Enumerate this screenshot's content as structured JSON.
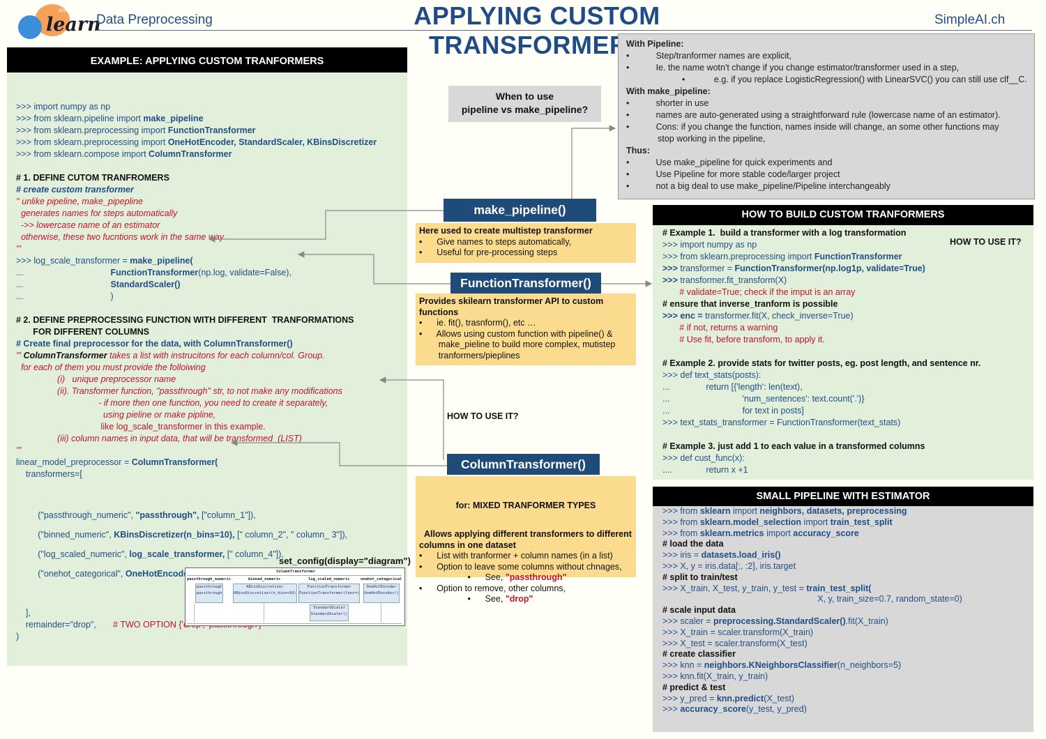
{
  "header": {
    "logo_word": "learn",
    "logo_tag": "scikit",
    "subtitle": "Data Preprocessing",
    "title": "APPLYING CUSTOM TRANSFORMERS",
    "site": "SimpleAI.ch"
  },
  "left": {
    "heading": "EXAMPLE: APPLYING CUSTOM TRANFORMERS",
    "lines": [
      [
        [
          "b",
          ">>> import numpy as np"
        ]
      ],
      [
        [
          "b",
          ">>> from sklearn.pipeline import "
        ],
        [
          "bb",
          "make_pipeline"
        ]
      ],
      [
        [
          "b",
          ">>> from sklearn.preprocessing import "
        ],
        [
          "bb",
          "FunctionTransformer"
        ]
      ],
      [
        [
          "b",
          ">>> from sklearn.preprocessing import "
        ],
        [
          "bb",
          "OneHotEncoder, StandardScaler, KBinsDiscretizer"
        ]
      ],
      [
        [
          "b",
          ">>> from sklearn.compose import "
        ],
        [
          "bb",
          "ColumnTransformer"
        ]
      ],
      [
        [
          "b",
          " "
        ]
      ],
      [
        [
          "k",
          "# 1. DEFINE CUTOM TRANFROMERS"
        ]
      ],
      [
        [
          "bi",
          "# create custom transformer"
        ]
      ],
      [
        [
          "r",
          "'' unlike pipeline, make_pipepline"
        ]
      ],
      [
        [
          "r",
          "  generates names for steps automatically"
        ]
      ],
      [
        [
          "r",
          "  ->> lowercase name of an estimator"
        ]
      ],
      [
        [
          "r",
          "  otherwise, these two fucntions work in the same way"
        ]
      ],
      [
        [
          "r",
          "'''"
        ]
      ],
      [
        [
          "b",
          ">>> log_scale_transformer = "
        ],
        [
          "bb",
          "make_pipeline("
        ]
      ],
      [
        [
          "b",
          "...                                    "
        ],
        [
          "bb",
          "FunctionTransformer"
        ],
        [
          "b",
          "(np.log, validate=False),"
        ]
      ],
      [
        [
          "b",
          "...                                    "
        ],
        [
          "bb",
          "StandardScaler()"
        ]
      ],
      [
        [
          "b",
          "...                                    )"
        ]
      ],
      [
        [
          "b",
          " "
        ]
      ],
      [
        [
          "k",
          "# 2. DEFINE PREPROCESSING FUNCTION WITH DIFFERENT  TRANFORMATIONS"
        ]
      ],
      [
        [
          "k",
          "       FOR DIFFERENT COLUMNS"
        ]
      ],
      [
        [
          "bb",
          "# Create final preprocessor for the data, with ColumnTransformer()"
        ]
      ],
      [
        [
          "r",
          "''' "
        ],
        [
          "ki",
          "ColumnTransformer"
        ],
        [
          "r",
          " takes a list with instrucitons for each column/col. Group."
        ]
      ],
      [
        [
          "r",
          "  for each of them you must provide the folloiwing"
        ]
      ],
      [
        [
          "r",
          "                 (i)   unique preprocessor name"
        ]
      ],
      [
        [
          "r",
          "                 (ii). Transformer function, \"passthrough\" str, to not make any modifications"
        ]
      ],
      [
        [
          "r",
          "                                  - if more then one function, you need to create it separately,"
        ]
      ],
      [
        [
          "r",
          "                                    using pieline or make pipline,"
        ]
      ],
      [
        [
          "rn",
          "                                   like log_scale_transformer in this example."
        ]
      ],
      [
        [
          "r",
          "                 (iii) column names in input data, that will be transformed  (LIST)"
        ]
      ],
      [
        [
          "r",
          "'''"
        ]
      ],
      [
        [
          "b",
          "linear_model_preprocessor = "
        ],
        [
          "bb",
          "ColumnTransformer("
        ]
      ],
      [
        [
          "b",
          "    transformers=["
        ]
      ]
    ],
    "tail_lines": [
      [
        [
          "b",
          "         (\"passthrough_numeric\", "
        ],
        [
          "bb",
          "\"passthrough\","
        ],
        [
          "b",
          " [\"column_1\"]),"
        ]
      ],
      [
        [
          "b",
          "         (\"binned_numeric\", "
        ],
        [
          "bb",
          "KBinsDiscretizer(n_bins=10),"
        ],
        [
          "b",
          " [\" column_2\", \" column_ 3\"]),"
        ]
      ],
      [
        [
          "b",
          "         (\"log_scaled_numeric\", "
        ],
        [
          "bb",
          "log_scale_transformer,"
        ],
        [
          "b",
          " [\" column_4\"]),"
        ]
      ],
      [
        [
          "b",
          "         (\"onehot_categorical\", "
        ],
        [
          "bb",
          "OneHotEncoder(),"
        ],
        [
          "b",
          " [\" column_5\", \" column_5\", \" column_6\"]),"
        ]
      ]
    ],
    "end_lines": [
      [
        [
          "b",
          "    ],"
        ]
      ],
      [
        [
          "b",
          "    remainder=\"drop\",       "
        ],
        [
          "rn",
          "# TWO OPTION {'drop', 'passthrough'}"
        ]
      ],
      [
        [
          "b",
          ")"
        ]
      ]
    ]
  },
  "gray": {
    "text": "With Pipeline:\n•           Step/tranformer names are explicit,\n•           Ie. the name wotn't change if you change estimator/transformer used in a step,\n                       •            e.g. if you replace LogisticRegression() with LinearSVC() you can still use clf__C.\nWith make_pipeline:\n•           shorter in use\n•           names are auto-generated using a straightforward rule (lowercase name of an estimator).\n•           Cons: if you change the function, names inside will change, an some other functions may\n             stop working in the pipeline,\nThus:\n•           Use make_pipeline for quick experiments and\n•           Use Pipeline for more stable code/larger project\n•           not a big deal to use make_pipeline/Pipeline interchangeably"
  },
  "middle": {
    "when": "When to use\npipeline vs make_pipeline?",
    "mp_title": "make_pipeline()",
    "mp_box": "Here used to create multistep transformer\n•      Give names to steps automatically,\n•      Useful for pre-processing steps",
    "ft_title": "FunctionTransformer()",
    "ft_box": "Provides skilearn transformer API to custom\nfunctions\n•      ie. fit(), trasnform(), etc …\n•      Allows using custom function with pipeline() &\n        make_pieline to build more complex, mutistep\n        tranformers/pieplines",
    "how_use": "HOW TO USE IT?",
    "ct_title": "ColumnTransformer()",
    "ct_sub": "for: MIXED TRANFORMER TYPES",
    "ct_box": "Allows applying different transformers to different\ncolumns in one dataset\n•      List with tranformer + column names (in a list)\n•      Option to leave some columns without chnages,\n                    •      See, ",
    "ct_pass": "\"passthrough\"",
    "ct_box2": "•      Option to remove, other columns,\n                    •      See, ",
    "ct_drop": "\"drop\"",
    "set_config": "set_config(display=\"diagram\")"
  },
  "diagram": {
    "root": "ColumnTransformer",
    "cols": [
      "passthrough_numeric",
      "binned_numeric",
      "log_scaled_numeric",
      "onehot_categorical"
    ],
    "boxes": [
      "passthrough\npassthrough",
      "KBinsDiscretizer\nKBinsDiscretizer(n_bins=10)",
      "FunctionTransformer\nFunctionTransformer(func=)",
      "OneHotEncoder\nOneHotEncoder()",
      "StandardScaler\nStandardScaler()"
    ]
  },
  "right1": {
    "heading": "HOW TO BUILD CUSTOM TRANFORMERS",
    "how_use": "HOW TO USE IT?",
    "lines": [
      [
        [
          "k",
          "# Example 1.  build a transformer with a log transformation"
        ]
      ],
      [
        [
          "b",
          ">>> import numpy as np"
        ]
      ],
      [
        [
          "b",
          ">>> from sklearn.preprocessing import "
        ],
        [
          "bb",
          "FunctionTransformer"
        ]
      ],
      [
        [
          "bb",
          ">>> "
        ],
        [
          "b",
          "transformer = "
        ],
        [
          "bb",
          "FunctionTransformer(np.log1p, validate=True)"
        ]
      ],
      [
        [
          "bb",
          ">>> "
        ],
        [
          "b",
          "transformer.fit_transform(X)"
        ]
      ],
      [
        [
          "rn",
          "       # validate=True; check if the imput is an array"
        ]
      ],
      [
        [
          "k",
          "# ensure that inverse_tranform is possible"
        ]
      ],
      [
        [
          "bb",
          ">>> enc = "
        ],
        [
          "b",
          "transformer.fit(X, check_inverse=True)"
        ]
      ],
      [
        [
          "rn",
          "       # if not, returns a warning"
        ]
      ],
      [
        [
          "rn",
          "       # Use fit, before transform, to apply it."
        ]
      ],
      [
        [
          "b",
          " "
        ]
      ],
      [
        [
          "k",
          "# Example 2. provide stats for twitter posts, eg. post length, and sentence nr."
        ]
      ],
      [
        [
          "b",
          ">>> def text_stats(posts):"
        ]
      ],
      [
        [
          "b",
          "...               return [{'length': len(text),"
        ]
      ],
      [
        [
          "b",
          "...                              'num_sentences': text.count('.')}"
        ]
      ],
      [
        [
          "b",
          "...                              for text in posts]"
        ]
      ],
      [
        [
          "b",
          ">>> text_stats_transformer = FunctionTransformer(text_stats)"
        ]
      ],
      [
        [
          "b",
          " "
        ]
      ],
      [
        [
          "k",
          "# Example 3. just add 1 to each value in a transformed columns"
        ]
      ],
      [
        [
          "b",
          ">>> def cust_func(x):"
        ]
      ],
      [
        [
          "b",
          "....              return x +1"
        ]
      ]
    ]
  },
  "right2": {
    "heading": "SMALL PIPELINE WITH ESTIMATOR",
    "lines": [
      [
        [
          "b",
          ">>> from "
        ],
        [
          "bb",
          "sklearn"
        ],
        [
          "b",
          " import "
        ],
        [
          "bb",
          "neighbors, datasets, preprocessing"
        ]
      ],
      [
        [
          "b",
          ">>> from "
        ],
        [
          "bb",
          "sklearn.model_selection"
        ],
        [
          "b",
          " import "
        ],
        [
          "bb",
          "train_test_split"
        ]
      ],
      [
        [
          "b",
          ">>> from "
        ],
        [
          "bb",
          "sklearn.metrics"
        ],
        [
          "b",
          " import "
        ],
        [
          "bb",
          "accuracy_score"
        ]
      ],
      [
        [
          "k",
          "# load the data"
        ]
      ],
      [
        [
          "b",
          ">>> iris = "
        ],
        [
          "bb",
          "datasets.load_iris()"
        ]
      ],
      [
        [
          "b",
          ">>> X, y = iris.data[:, :2], iris.target"
        ]
      ],
      [
        [
          "k",
          "# split to train/test"
        ]
      ],
      [
        [
          "b",
          ">>> X_train, X_test, y_train, y_test = "
        ],
        [
          "bb",
          "train_test_split("
        ]
      ],
      [
        [
          "b",
          "                                                                X, y, train_size=0.7, random_state=0)"
        ]
      ],
      [
        [
          "k",
          "# scale input data"
        ]
      ],
      [
        [
          "b",
          ">>> scaler = "
        ],
        [
          "bb",
          "preprocessing.StandardScaler()"
        ],
        [
          "b",
          ".fit(X_train)"
        ]
      ],
      [
        [
          "b",
          ">>> X_train = scaler.transform(X_train)"
        ]
      ],
      [
        [
          "b",
          ">>> X_test = scaler.transform(X_test)"
        ]
      ],
      [
        [
          "k",
          "# create classifier"
        ]
      ],
      [
        [
          "b",
          ">>> knn = "
        ],
        [
          "bb",
          "neighbors.KNeighborsClassifier"
        ],
        [
          "b",
          "(n_neighbors=5)"
        ]
      ],
      [
        [
          "b",
          ">>> knn.fit(X_train, y_train)"
        ]
      ],
      [
        [
          "k",
          "# predict & test"
        ]
      ],
      [
        [
          "b",
          ">>> y_pred = "
        ],
        [
          "bb",
          "knn.predict"
        ],
        [
          "b",
          "(X_test)"
        ]
      ],
      [
        [
          "b",
          ">>> "
        ],
        [
          "bb",
          "accuracy_score"
        ],
        [
          "b",
          "(y_test, y_pred)"
        ]
      ]
    ]
  },
  "colors": {
    "accent_blue": "#1f4b78",
    "panel_green": "#e2efdb",
    "note_yellow": "#fbdc8e",
    "gray": "#d8d8d8",
    "red": "#c0142a"
  }
}
